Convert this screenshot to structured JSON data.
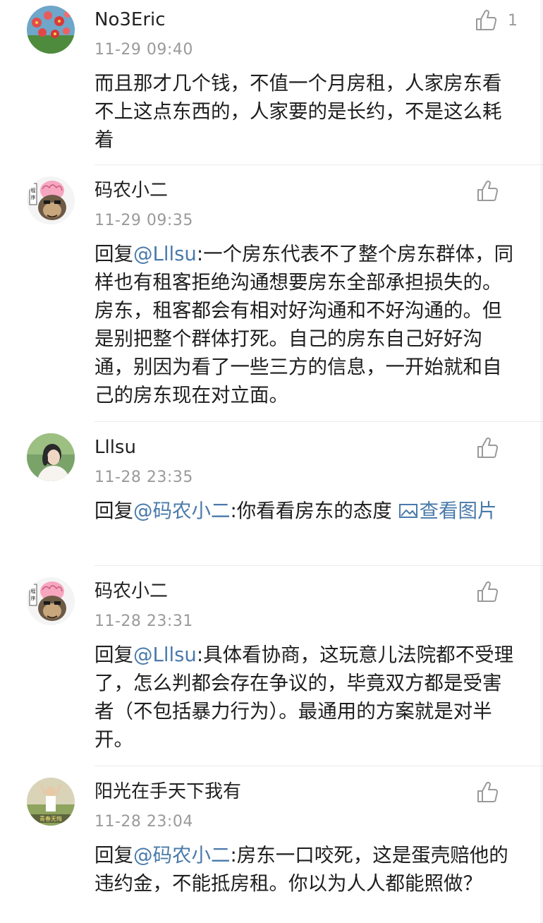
{
  "comments": [
    {
      "username": "No3Eric",
      "time": "11-29 09:40",
      "likes": "1",
      "text": "而且那才几个钱，不值一个月房租，人家房东看不上这点东西的，人家要的是长约，不是这么耗着"
    },
    {
      "username": "码农小二",
      "time": "11-29 09:35",
      "likes": "",
      "reply_prefix": "回复",
      "mention": "@Lllsu",
      "text": ":一个房东代表不了整个房东群体，同样也有租客拒绝沟通想要房东全部承担损失的。房东，租客都会有相对好沟通和不好沟通的。但是别把整个群体打死。自己的房东自己好好沟通，别因为看了一些三方的信息，一开始就和自己的房东现在对立面。"
    },
    {
      "username": "Lllsu",
      "time": "11-28 23:35",
      "likes": "",
      "reply_prefix": "回复",
      "mention": "@码农小二",
      "text": ":你看看房东的态度 ",
      "view_image_label": "查看图片"
    },
    {
      "username": "码农小二",
      "time": "11-28 23:31",
      "likes": "",
      "reply_prefix": "回复",
      "mention": "@Lllsu",
      "text": ":具体看协商，这玩意儿法院都不受理了，怎么判都会存在争议的，毕竟双方都是受害者（不包括暴力行为）。最通用的方案就是对半开。"
    },
    {
      "username": "阳光在手天下我有",
      "time": "11-28 23:04",
      "likes": "",
      "reply_prefix": "回复",
      "mention": "@码农小二",
      "text": ":房东一口咬死，这是蛋壳赔他的违约金，不能抵房租。你以为人人都能照做？"
    }
  ],
  "colors": {
    "link": "#4a7aaa",
    "meta": "#9a9a9a",
    "text": "#1e1e1e"
  },
  "icons": {
    "like": "thumbs-up-icon",
    "image": "image-icon"
  }
}
